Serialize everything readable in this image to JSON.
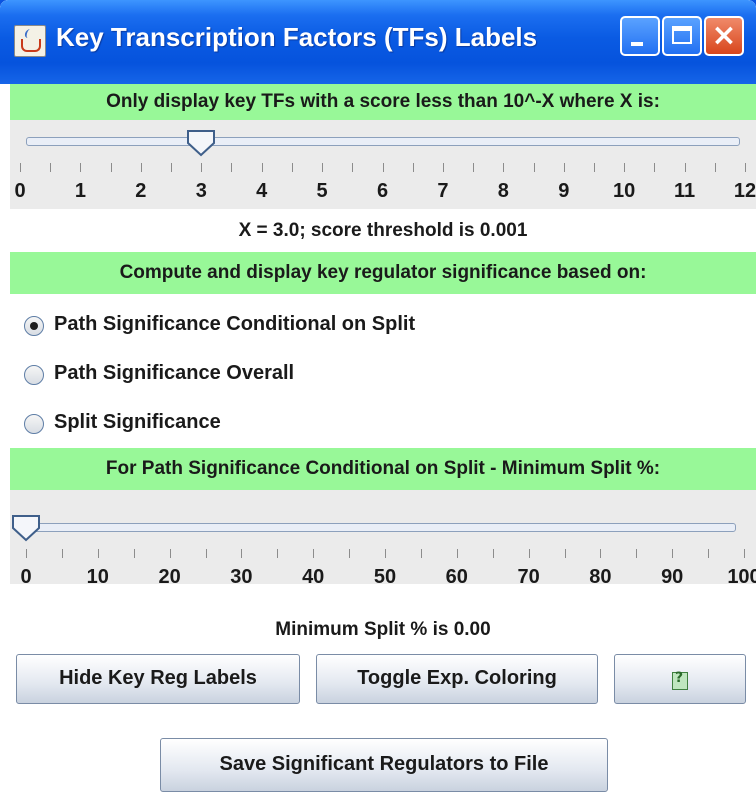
{
  "window": {
    "title": "Key Transcription Factors (TFs) Labels",
    "controls": {
      "minimize": "minimize",
      "maximize": "maximize",
      "close": "×"
    }
  },
  "score_section": {
    "heading": "Only display key TFs with a score less than 10^-X where X is:",
    "slider": {
      "min": 0,
      "max": 12,
      "value": 3
    },
    "tick_labels": [
      "0",
      "1",
      "2",
      "3",
      "4",
      "5",
      "6",
      "7",
      "8",
      "9",
      "10",
      "11",
      "12"
    ],
    "status": "X = 3.0;  score threshold is 0.001"
  },
  "significance_section": {
    "heading": "Compute and display key regulator significance based on:",
    "options": [
      {
        "label": "Path Significance Conditional on Split",
        "selected": true
      },
      {
        "label": "Path Significance Overall",
        "selected": false
      },
      {
        "label": "Split Significance",
        "selected": false
      }
    ]
  },
  "split_section": {
    "heading": "For Path Significance Conditional on Split - Minimum Split %:",
    "slider": {
      "min": 0,
      "max": 100,
      "value": 0
    },
    "tick_labels": [
      "0",
      "10",
      "20",
      "30",
      "40",
      "50",
      "60",
      "70",
      "80",
      "90",
      "100"
    ],
    "status": "Minimum Split % is 0.00"
  },
  "buttons": {
    "hide_labels": "Hide Key Reg Labels",
    "toggle_coloring": "Toggle Exp. Coloring",
    "help_icon": "help-icon",
    "save": "Save Significant Regulators to File"
  },
  "colors": {
    "title_bar": "#0653dd",
    "section_bg": "#98f898",
    "close_button": "#d8461c"
  }
}
